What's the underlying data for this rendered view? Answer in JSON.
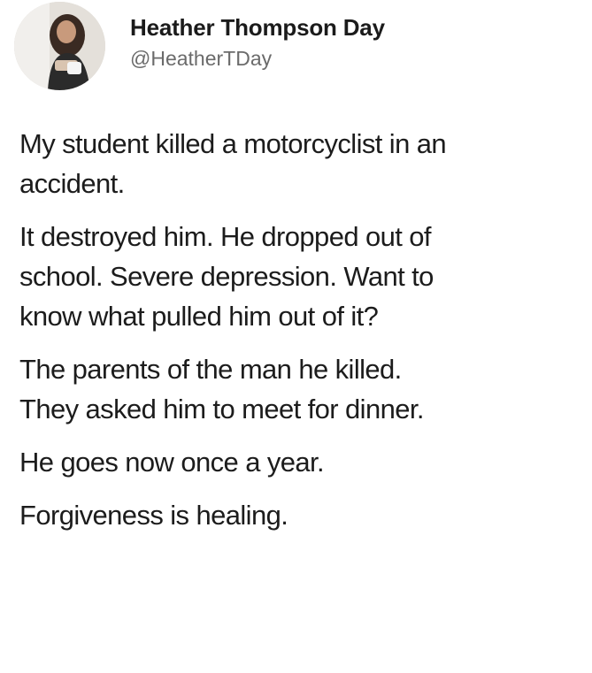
{
  "tweet": {
    "author": {
      "display_name": "Heather Thompson Day",
      "handle": "@HeatherTDay",
      "avatar_icon": "profile-photo"
    },
    "paragraphs": [
      {
        "lines": [
          "My student killed a motorcyclist in an",
          "accident."
        ]
      },
      {
        "lines": [
          "It destroyed him. He dropped out of",
          "school. Severe depression. Want to",
          "know what pulled him out of it?"
        ]
      },
      {
        "lines": [
          "The parents of the man he killed.",
          "They asked him to meet for dinner."
        ]
      },
      {
        "lines": [
          "He goes now once a year."
        ]
      },
      {
        "lines": [
          "Forgiveness is healing."
        ]
      }
    ]
  }
}
